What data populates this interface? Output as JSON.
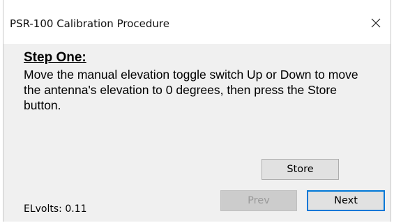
{
  "window": {
    "title": "PSR-100 Calibration Procedure",
    "close_icon": "close-icon"
  },
  "step": {
    "heading": "Step One:",
    "instructions": "Move the manual elevation toggle switch Up or Down to move the antenna's elevation to 0 degrees, then press the Store button."
  },
  "buttons": {
    "store_label": "Store",
    "prev_label": "Prev",
    "next_label": "Next",
    "prev_enabled": false
  },
  "status": {
    "elvolts_text": "ELvolts: 0.11"
  },
  "colors": {
    "client_background": "#f0f0f0",
    "button_background": "#e1e1e1",
    "focus_border": "#0078d7",
    "disabled_text": "#9a9a9a"
  }
}
